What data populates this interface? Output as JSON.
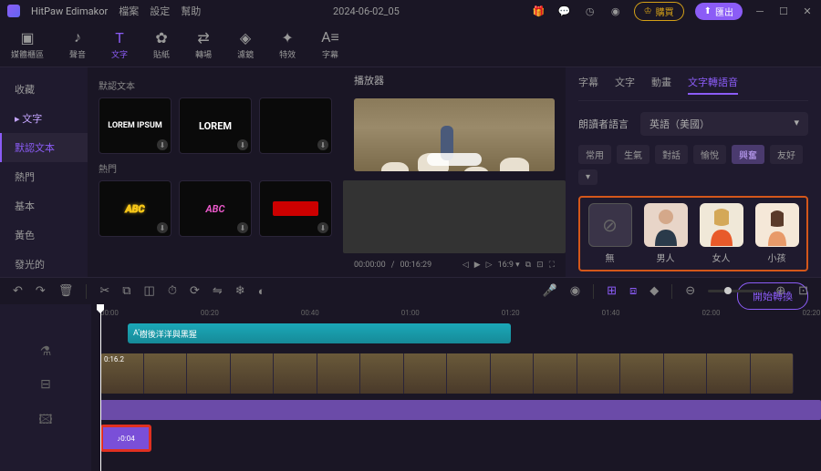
{
  "app": {
    "name": "HitPaw Edimakor",
    "date": "2024-06-02_05"
  },
  "menu": {
    "file": "檔案",
    "settings": "設定",
    "help": "幫助"
  },
  "header_btn": {
    "crown": "購買",
    "export": "匯出"
  },
  "tools": {
    "media": "媒體櫃區",
    "audio": "聲音",
    "text": "文字",
    "sticker": "貼紙",
    "transition": "轉場",
    "filter": "濾鏡",
    "effect": "特效",
    "subtitle": "字幕"
  },
  "sidebar": {
    "favorites": "收藏",
    "text": "文字",
    "items": [
      "默認文本",
      "熱門",
      "基本",
      "黃色",
      "發光的"
    ]
  },
  "templates": {
    "section1": "默認文本",
    "section2": "熱門",
    "card1": "LOREM IPSUM",
    "card2": "LOREM",
    "card3": "",
    "card4": "ABC",
    "card5": "ABC",
    "card6": ""
  },
  "preview": {
    "title": "播放器",
    "time_current": "00:00:00",
    "time_total": "00:16:29",
    "ratio": "16:9"
  },
  "panel": {
    "tabs": {
      "subtitle": "字幕",
      "text": "文字",
      "anim": "動畫",
      "tts": "文字轉語音"
    },
    "lang_label": "朗讀者語言",
    "lang_value": "英語（美國）",
    "chips": [
      "常用",
      "生氣",
      "對話",
      "愉悅",
      "興奮",
      "友好"
    ],
    "voices": {
      "none": "無",
      "man": "男人",
      "woman": "女人",
      "child": "小孩"
    },
    "convert": "開始轉換"
  },
  "timeline": {
    "ruler": [
      "00:00",
      "00:20",
      "00:40",
      "01:00",
      "01:20",
      "01:40",
      "02:00",
      "02:20"
    ],
    "text_clip": "樹後洋洋與黑猩",
    "video_dur": "0:16.2",
    "tts_dur": "0:04"
  }
}
